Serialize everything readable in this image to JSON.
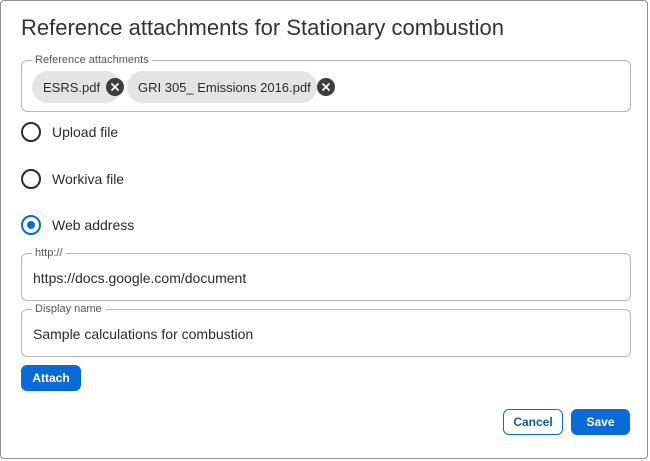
{
  "dialog": {
    "title": "Reference attachments for Stationary combustion"
  },
  "attachments": {
    "legend": "Reference attachments",
    "chips": [
      {
        "label": "ESRS.pdf",
        "remove_icon": "close-circle-icon"
      },
      {
        "label": "GRI 305_ Emissions 2016.pdf",
        "remove_icon": "close-circle-icon"
      }
    ]
  },
  "source_options": [
    {
      "label": "Upload file",
      "checked": false
    },
    {
      "label": "Workiva file",
      "checked": false
    },
    {
      "label": "Web address",
      "checked": true
    }
  ],
  "url_field": {
    "legend": "http://",
    "value": "https://docs.google.com/document"
  },
  "display_name_field": {
    "legend": "Display name",
    "value": "Sample calculations for combustion"
  },
  "buttons": {
    "attach": "Attach",
    "cancel": "Cancel",
    "save": "Save"
  },
  "colors": {
    "accent": "#0a6bd6",
    "chip_background": "#e4e4e4",
    "chip_close": "#3d3d3d"
  }
}
